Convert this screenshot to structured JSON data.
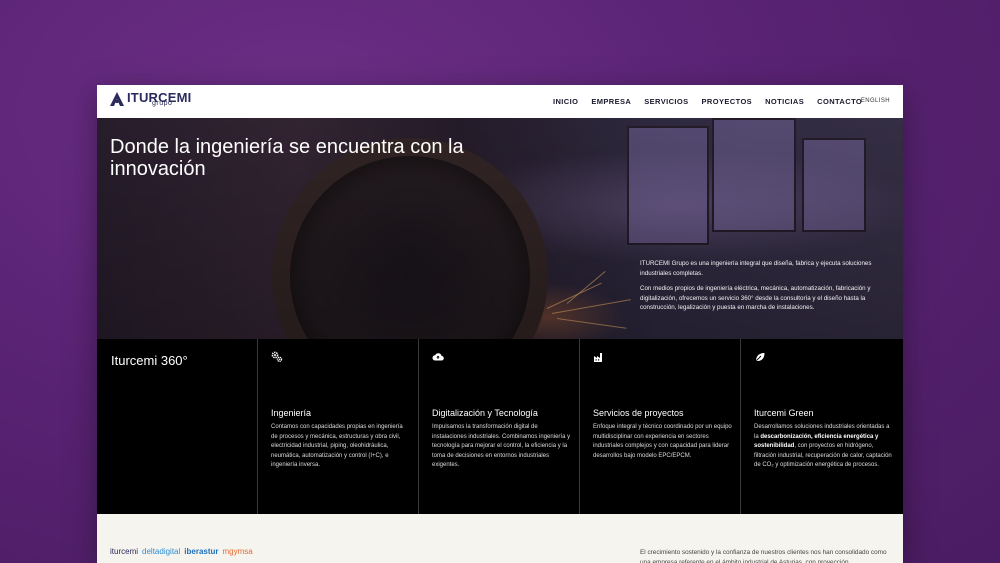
{
  "header": {
    "logo_text": "ITURCEMI",
    "logo_sub": "grupo",
    "nav": [
      "INICIO",
      "EMPRESA",
      "SERVICIOS",
      "PROYECTOS",
      "NOTICIAS",
      "CONTACTO"
    ],
    "lang": "ENGLISH"
  },
  "hero": {
    "title": "Donde la ingeniería se encuentra con la innovación",
    "desc_1": "ITURCEMI Grupo es una ingeniería integral que diseña, fabrica y ejecuta soluciones industriales completas.",
    "desc_2": "Con medios propios de ingeniería eléctrica, mecánica, automatización, fabricación y digitalización, ofrecemos un servicio 360° desde la consultoría y el diseño hasta la construcción, legalización y puesta en marcha de instalaciones."
  },
  "services": {
    "intro_title": "Iturcemi 360°",
    "items": [
      {
        "icon": "gears-icon",
        "title": "Ingeniería",
        "text": "Contamos con capacidades propias en ingeniería de procesos y mecánica, estructuras y obra civil, electricidad industrial, piping, oleohidráulica, neumática, automatización y control (I+C), e ingeniería inversa."
      },
      {
        "icon": "cloud-upload-icon",
        "title": "Digitalización y Tecnología",
        "text": "Impulsamos la transformación digital de instalaciones industriales. Combinamos ingeniería y tecnología para mejorar el control, la eficiencia y la toma de decisiones en entornos industriales exigentes."
      },
      {
        "icon": "factory-icon",
        "title": "Servicios de proyectos",
        "text": "Enfoque integral y técnico coordinado por un equipo multidisciplinar con experiencia en sectores industriales complejos y con capacidad para liderar desarrollos bajo modelo EPC/EPCM."
      },
      {
        "icon": "leaf-icon",
        "title": "Iturcemi Green",
        "text_pre": "Desarrollamos soluciones industriales orientadas a la ",
        "text_bold": "descarbonización, eficiencia energética y sostenibilidad",
        "text_post": ", con proyectos en hidrógeno, filtración industrial, recuperación de calor, captación de CO₂ y optimización energética de procesos."
      }
    ]
  },
  "footer": {
    "brands": [
      {
        "name": "iturcemi",
        "color": "#2a2a5c"
      },
      {
        "name": "deltadigital",
        "color": "#2a8fd4"
      },
      {
        "name": "iberastur",
        "color": "#1e6fb8"
      },
      {
        "name": "mgymsa",
        "color": "#e26a2c"
      }
    ],
    "text": "El crecimiento sostenido y la confianza de nuestros clientes nos han consolidado como una empresa referente en el ámbito industrial de Asturias, con proyección"
  },
  "colors": {
    "background": "#5a2374",
    "brand": "#2a2a5c",
    "services_bg": "#000000"
  }
}
